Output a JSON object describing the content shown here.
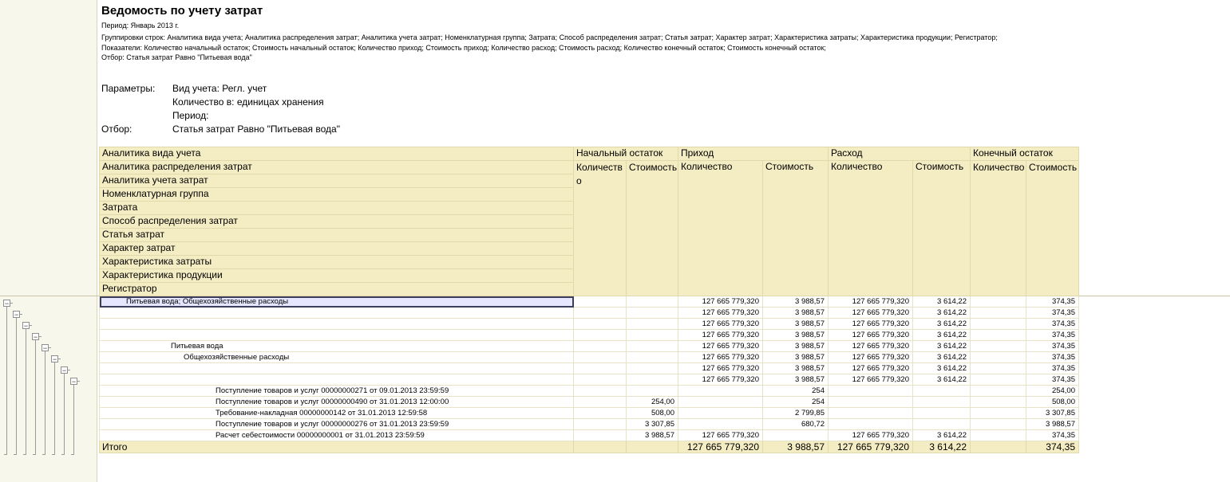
{
  "report": {
    "title": "Ведомость по учету затрат",
    "period": "Период: Январь 2013 г.",
    "groupings": "Группировки строк: Аналитика вида учета; Аналитика распределения затрат; Аналитика учета затрат; Номенклатурная группа; Затрата; Способ распределения затрат; Статья затрат; Характер затрат; Характеристика затраты; Характеристика продукции; Регистратор;",
    "indicators": "Показатели: Количество начальный остаток; Стоимость начальный остаток; Количество приход; Стоимость приход; Количество расход; Стоимость расход; Количество конечный остаток; Стоимость конечный остаток;",
    "filter": "Отбор: Статья затрат Равно \"Питьевая вода\""
  },
  "params": {
    "label": "Параметры:",
    "account_type": "Вид учета: Регл. учет",
    "quantity_in": "Количество в: единицах хранения",
    "period": "Период:",
    "filter_label": "Отбор:",
    "filter_value": "Статья затрат Равно \"Питьевая вода\""
  },
  "header": {
    "row_groups": [
      "Аналитика вида учета",
      "Аналитика распределения затрат",
      "Аналитика учета затрат",
      "Номенклатурная группа",
      "Затрата",
      "Способ распределения затрат",
      "Статья затрат",
      "Характер затрат",
      "Характеристика затраты",
      "Характеристика продукции",
      "Регистратор"
    ],
    "group_start": "Начальный остаток",
    "group_in": "Приход",
    "group_out": "Расход",
    "group_end": "Конечный остаток",
    "qty_start": "Количество",
    "cost_start": "Стоимость",
    "qty_in": "Количество",
    "cost_in": "Стоимость",
    "qty_out": "Количество",
    "cost_out": "Стоимость",
    "qty_end": "Количество",
    "cost_end": "Стоимость"
  },
  "rows": [
    {
      "label": "Питьевая вода; Общехозяйственные расходы",
      "c1": "",
      "c2": "",
      "c3": "127 665 779,320",
      "c4": "3 988,57",
      "c5": "127 665 779,320",
      "c6": "3 614,22",
      "c7": "",
      "c8": "374,35"
    },
    {
      "label": "",
      "c1": "",
      "c2": "",
      "c3": "127 665 779,320",
      "c4": "3 988,57",
      "c5": "127 665 779,320",
      "c6": "3 614,22",
      "c7": "",
      "c8": "374,35"
    },
    {
      "label": "",
      "c1": "",
      "c2": "",
      "c3": "127 665 779,320",
      "c4": "3 988,57",
      "c5": "127 665 779,320",
      "c6": "3 614,22",
      "c7": "",
      "c8": "374,35"
    },
    {
      "label": "",
      "c1": "",
      "c2": "",
      "c3": "127 665 779,320",
      "c4": "3 988,57",
      "c5": "127 665 779,320",
      "c6": "3 614,22",
      "c7": "",
      "c8": "374,35"
    },
    {
      "label": "Питьевая вода",
      "c1": "",
      "c2": "",
      "c3": "127 665 779,320",
      "c4": "3 988,57",
      "c5": "127 665 779,320",
      "c6": "3 614,22",
      "c7": "",
      "c8": "374,35"
    },
    {
      "label": "Общехозяйственные расходы",
      "c1": "",
      "c2": "",
      "c3": "127 665 779,320",
      "c4": "3 988,57",
      "c5": "127 665 779,320",
      "c6": "3 614,22",
      "c7": "",
      "c8": "374,35"
    },
    {
      "label": "",
      "c1": "",
      "c2": "",
      "c3": "127 665 779,320",
      "c4": "3 988,57",
      "c5": "127 665 779,320",
      "c6": "3 614,22",
      "c7": "",
      "c8": "374,35"
    },
    {
      "label": "",
      "c1": "",
      "c2": "",
      "c3": "127 665 779,320",
      "c4": "3 988,57",
      "c5": "127 665 779,320",
      "c6": "3 614,22",
      "c7": "",
      "c8": "374,35"
    },
    {
      "label": "Поступление товаров и услуг 00000000271 от 09.01.2013 23:59:59",
      "c1": "",
      "c2": "",
      "c3": "",
      "c4": "254",
      "c5": "",
      "c6": "",
      "c7": "",
      "c8": "254,00"
    },
    {
      "label": "Поступление товаров и услуг 00000000490 от 31.01.2013 12:00:00",
      "c1": "",
      "c2": "254,00",
      "c3": "",
      "c4": "254",
      "c5": "",
      "c6": "",
      "c7": "",
      "c8": "508,00"
    },
    {
      "label": "Требование-накладная 00000000142 от 31.01.2013 12:59:58",
      "c1": "",
      "c2": "508,00",
      "c3": "",
      "c4": "2 799,85",
      "c5": "",
      "c6": "",
      "c7": "",
      "c8": "3 307,85"
    },
    {
      "label": "Поступление товаров и услуг 00000000276 от 31.01.2013 23:59:59",
      "c1": "",
      "c2": "3 307,85",
      "c3": "",
      "c4": "680,72",
      "c5": "",
      "c6": "",
      "c7": "",
      "c8": "3 988,57"
    },
    {
      "label": "Расчет себестоимости 00000000001 от 31.01.2013 23:59:59",
      "c1": "",
      "c2": "3 988,57",
      "c3": "127 665 779,320",
      "c4": "",
      "c5": "127 665 779,320",
      "c6": "3 614,22",
      "c7": "",
      "c8": "374,35"
    }
  ],
  "total": {
    "label": "Итого",
    "c1": "",
    "c2": "",
    "c3": "127 665 779,320",
    "c4": "3 988,57",
    "c5": "127 665 779,320",
    "c6": "3 614,22",
    "c7": "",
    "c8": "374,35"
  }
}
